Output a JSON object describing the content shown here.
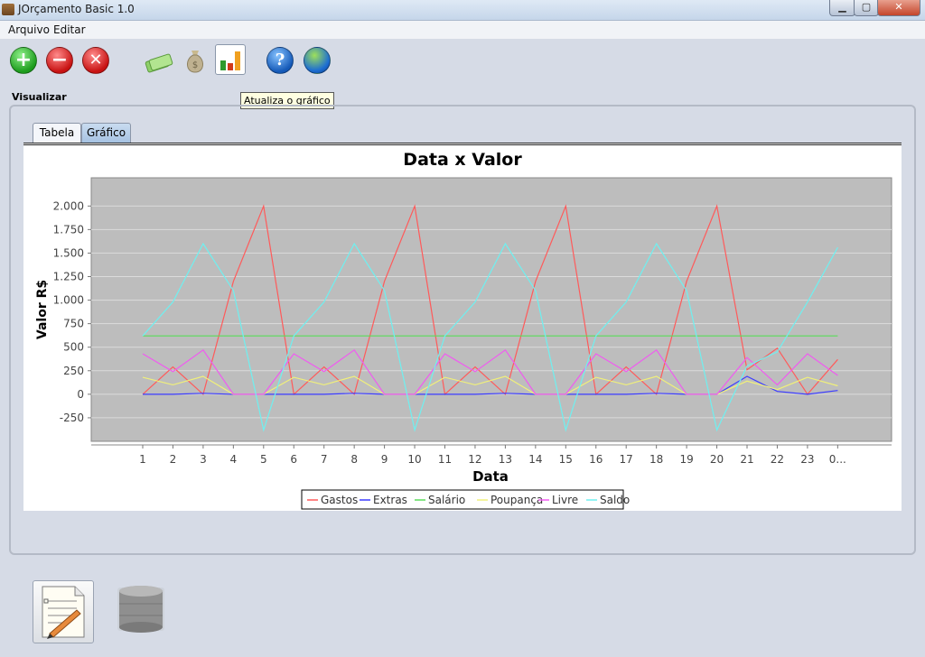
{
  "window": {
    "title": "JOrçamento Basic 1.0"
  },
  "menu": {
    "items": [
      "Arquivo",
      "Editar"
    ]
  },
  "toolbar": {
    "tooltip": "Atualiza o gráfico"
  },
  "view": {
    "label": "Visualizar",
    "tabs": [
      "Tabela",
      "Gráfico"
    ],
    "active_tab": "Gráfico"
  },
  "chart_data": {
    "type": "line",
    "title": "Data x Valor",
    "xlabel": "Data",
    "ylabel": "Valor R$",
    "categories": [
      "1",
      "2",
      "3",
      "4",
      "5",
      "6",
      "7",
      "8",
      "9",
      "10",
      "11",
      "12",
      "13",
      "14",
      "15",
      "16",
      "17",
      "18",
      "19",
      "20",
      "21",
      "22",
      "23",
      "0..."
    ],
    "ylim": [
      -500,
      2300
    ],
    "yticks": [
      2000,
      1750,
      1500,
      1250,
      1000,
      750,
      500,
      250,
      0,
      -250
    ],
    "ytick_labels": [
      "2.000",
      "1.750",
      "1.500",
      "1.250",
      "1.000",
      "750",
      "500",
      "250",
      "0",
      "-250"
    ],
    "grid": true,
    "legend_position": "bottom",
    "series": [
      {
        "name": "Gastos",
        "color": "#ff5a5a",
        "values": [
          0,
          290,
          0,
          1200,
          2000,
          0,
          290,
          0,
          1200,
          2000,
          0,
          290,
          0,
          1200,
          2000,
          0,
          290,
          0,
          1200,
          2000,
          260,
          490,
          0,
          370
        ]
      },
      {
        "name": "Extras",
        "color": "#3b3bff",
        "values": [
          0,
          0,
          10,
          0,
          0,
          0,
          0,
          10,
          0,
          0,
          0,
          0,
          10,
          0,
          0,
          0,
          0,
          10,
          0,
          0,
          190,
          30,
          0,
          40
        ]
      },
      {
        "name": "Salário",
        "color": "#5adc5a",
        "values": [
          620,
          620,
          620,
          620,
          620,
          620,
          620,
          620,
          620,
          620,
          620,
          620,
          620,
          620,
          620,
          620,
          620,
          620,
          620,
          620,
          620,
          620,
          620,
          620
        ]
      },
      {
        "name": "Poupança",
        "color": "#f0f07a",
        "values": [
          180,
          100,
          190,
          0,
          0,
          180,
          100,
          190,
          0,
          0,
          180,
          100,
          190,
          0,
          0,
          180,
          100,
          190,
          0,
          0,
          140,
          50,
          180,
          90
        ]
      },
      {
        "name": "Livre",
        "color": "#f05af0",
        "values": [
          430,
          240,
          470,
          0,
          0,
          430,
          240,
          470,
          0,
          0,
          430,
          240,
          470,
          0,
          0,
          430,
          240,
          470,
          0,
          0,
          390,
          100,
          430,
          200
        ]
      },
      {
        "name": "Saldo",
        "color": "#6ff0f0",
        "values": [
          620,
          980,
          1600,
          1100,
          -380,
          620,
          980,
          1600,
          1100,
          -380,
          620,
          980,
          1600,
          1100,
          -380,
          620,
          980,
          1600,
          1100,
          -380,
          300,
          450,
          980,
          1560
        ]
      }
    ]
  }
}
